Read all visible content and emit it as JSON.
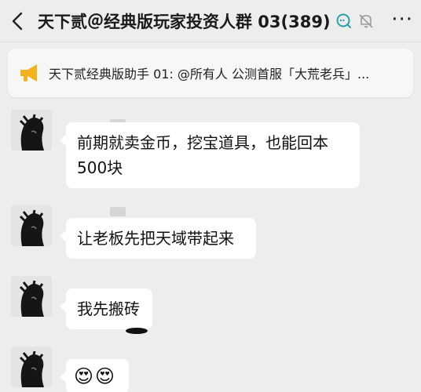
{
  "header": {
    "back_icon": "chevron-left-icon",
    "title": "天下贰＠经典版玩家投资人群 03(389)",
    "more_label": "···"
  },
  "notice": {
    "icon": "megaphone-icon",
    "text": "天下贰经典版助手 01: @所有人  公测首服「大荒老兵」..."
  },
  "messages": [
    {
      "text_line1": "前期就卖金币，挖宝道具，也能回本",
      "text_line2": "500块"
    },
    {
      "text": "让老板先把天域带起来"
    },
    {
      "text": "我先搬砖"
    },
    {
      "text": "😍😍"
    }
  ],
  "colors": {
    "background": "#ededed",
    "bubble": "#ffffff",
    "icon_teal": "#2aa1a6",
    "megaphone": "#f5b21f"
  }
}
